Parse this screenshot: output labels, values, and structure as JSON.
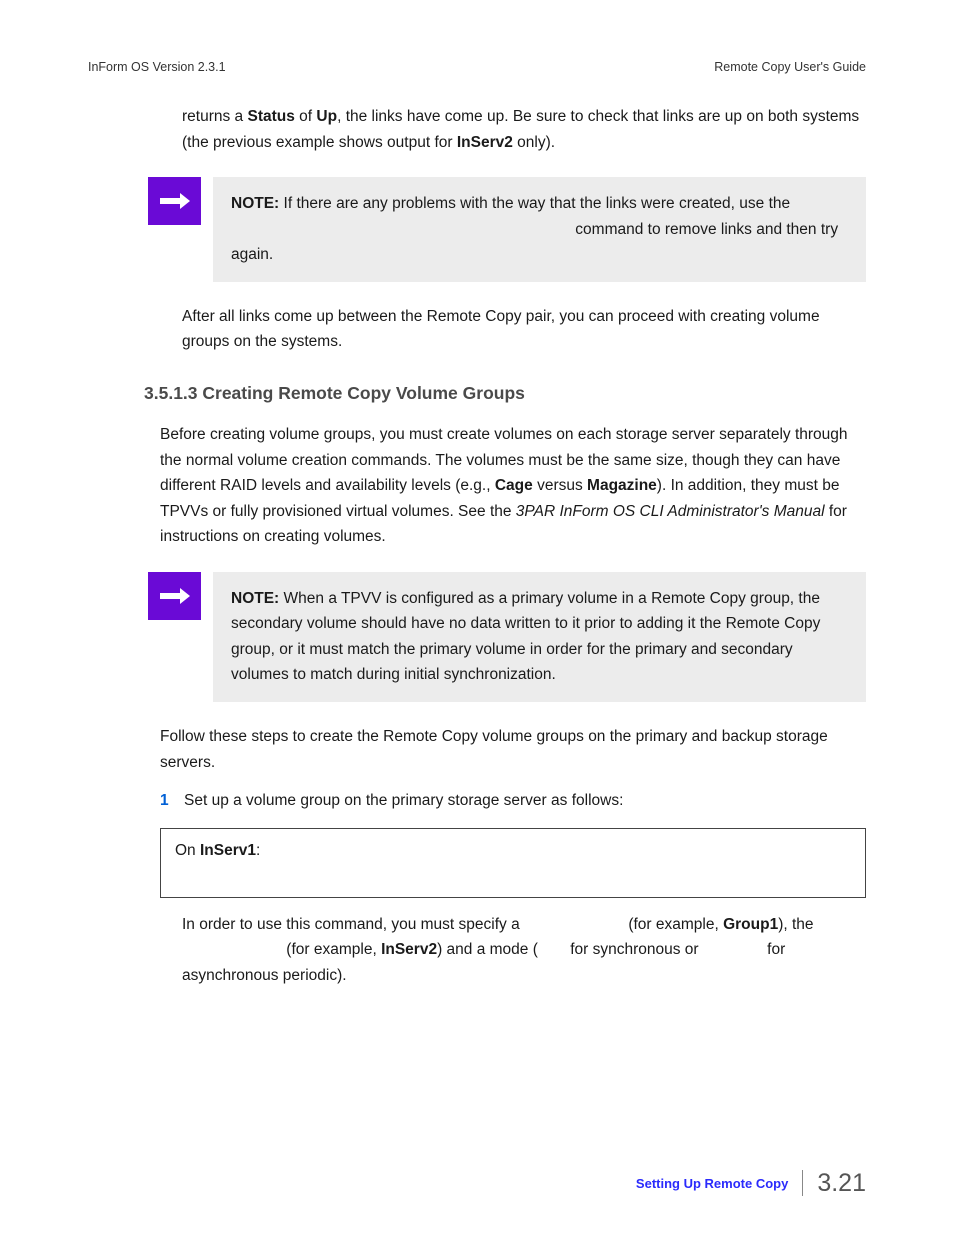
{
  "header": {
    "left": "InForm OS Version 2.3.1",
    "right": "Remote Copy User's Guide"
  },
  "p1": {
    "t1": "returns a ",
    "b1": "Status",
    "t2": " of ",
    "b2": "Up",
    "t3": ", the links have come up. Be sure to check that links are up on both systems (the previous example shows output for ",
    "b3": "InServ2",
    "t4": " only)."
  },
  "note1": {
    "label": "NOTE:",
    "t1": " If there are any problems with the way that the links were created, use the ",
    "t2": " command to remove links and then try again."
  },
  "p2": "After all links come up between the Remote Copy pair, you can proceed with creating volume groups on the systems.",
  "heading": "3.5.1.3 Creating Remote Copy Volume Groups",
  "p3": {
    "t1": "Before creating volume groups, you must create volumes on each storage server separately through the normal volume creation commands. The volumes must be the same size, though they can have different RAID levels and availability levels (e.g., ",
    "b1": "Cage",
    "t2": " versus ",
    "b2": "Magazine",
    "t3": "). In addition, they must be TPVVs or fully provisioned virtual volumes. See the ",
    "i1": "3PAR InForm OS CLI Administrator's Manual",
    "t4": " for instructions on creating volumes."
  },
  "note2": {
    "label": "NOTE:",
    "t1": " When a TPVV is configured as a primary volume in a Remote Copy group, the secondary volume should have no data written to it prior to adding it the Remote Copy group, or it must match the primary volume in order for the primary and secondary volumes to match during initial synchronization."
  },
  "p4": "Follow these steps to create the Remote Copy volume groups on the primary and backup storage servers.",
  "step1": {
    "num": "1",
    "text": "Set up a volume group on the primary storage server as follows:"
  },
  "codebox": {
    "t1": "On ",
    "b1": "InServ1",
    "t2": ":"
  },
  "p5": {
    "t1": "In order to use this command, you must specify a ",
    "t2": " (for example, ",
    "b1": "Group1",
    "t3": "), the ",
    "t4": " (for example, ",
    "b2": "InServ2",
    "t5": ") and a mode (",
    "t6": " for synchronous or ",
    "t7": " for asynchronous periodic)."
  },
  "footer": {
    "link": "Setting Up Remote Copy",
    "pagenum": "3.21"
  }
}
